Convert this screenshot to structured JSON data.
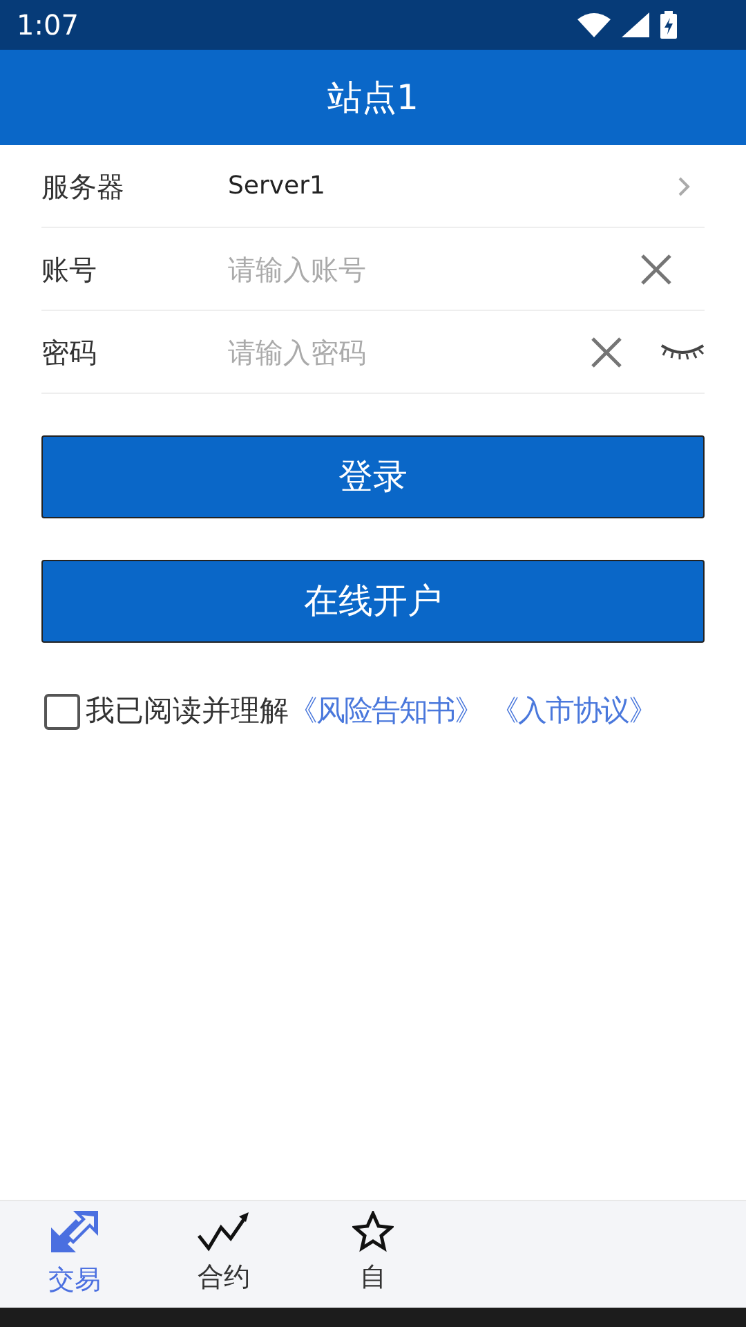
{
  "status_bar": {
    "time": "1:07"
  },
  "title": "站点1",
  "form": [
    {
      "kind": "select",
      "label": "服务器",
      "value": "Server1"
    },
    {
      "kind": "text",
      "label": "账号",
      "placeholder": "请输入账号"
    },
    {
      "kind": "password",
      "label": "密码",
      "placeholder": "请输入密码"
    }
  ],
  "buttons": [
    "登录",
    "在线开户"
  ],
  "agreement": {
    "checked": false,
    "text": "我已阅读并理解",
    "links": [
      "《风险告知书》",
      "《入市协议》"
    ]
  },
  "tabs": [
    {
      "label": "交易",
      "kind": "trade",
      "selected": true
    },
    {
      "label": "合约",
      "kind": "chart",
      "selected": false
    },
    {
      "label": "自",
      "kind": "favorite",
      "selected": false
    }
  ]
}
